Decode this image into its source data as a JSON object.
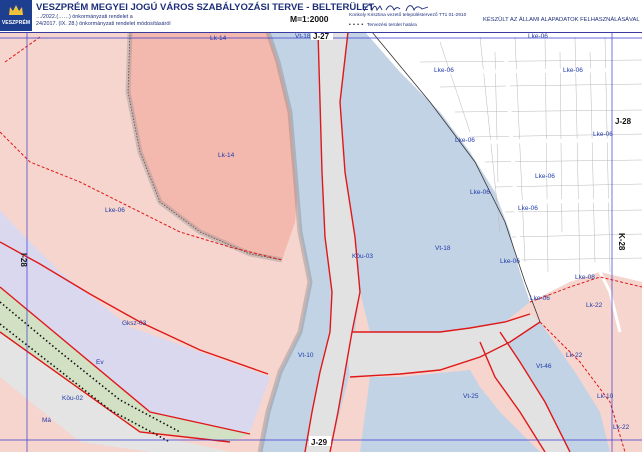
{
  "header": {
    "logo_text": "VESZPRÉM",
    "title": "VESZPRÉM MEGYEI JOGÚ VÁROS SZABÁLYOZÁSI TERVE  -  BELTERÜLET",
    "ordinance_1": "…/2022.(……) önkormányzati rendelet a",
    "ordinance_2": "24/2017. (IX. 28.) önkormányzati rendelet módosításáról",
    "scale": "M=1:2000",
    "designer": "Konkoly Krisztina vezető településtervező   TT1 01-2910",
    "legend_dots": "• • • •",
    "legend_text": "Tervezési terület határa",
    "basemap_note": "KÉSZÜLT AZ ÁLLAMI ALAPADATOK FELHASZNÁLÁSÁVAL"
  },
  "sheets": {
    "top_center": "J-27",
    "bottom_center": "J-29",
    "right_top": "J-28",
    "left": "I-28",
    "right": "K-28"
  },
  "zones": {
    "lk14_top": "Lk-14",
    "lk14_main": "Lk-14",
    "lke06_left": "Lke-06",
    "gksz03": "Gksz-03",
    "ev": "Ev",
    "kou02": "Köu-02",
    "mu": "Má",
    "vt18_top": "Vt-18",
    "vt18": "Vt-18",
    "vt10": "Vt-10",
    "kou03": "Köu-03",
    "vt25": "Vt-25",
    "vt46": "Vt-46",
    "lke06_a": "Lke-06",
    "lke06_b": "Lke-06",
    "lke06_c": "Lke-06",
    "lke06_d": "Lke-06",
    "lke06_e": "Lke-06",
    "lke06_f": "Lke-06",
    "lke06_g": "Lke-06",
    "lke06_h": "Lke-06",
    "lke06_i": "Lke-06",
    "lke06_j": "Lke-06",
    "lke08": "Lke-08",
    "lk22_a": "Lk-22",
    "lk22_b": "Lk-22",
    "lk22_c": "Lk-22",
    "lk10": "Lk-10"
  },
  "colors": {
    "pink_residential": "#f5d5ce",
    "rose_residential": "#f3b8ae",
    "lilac_commercial": "#d9d8ef",
    "blue_building": "#c3d3e6",
    "green_strip": "#d2e0c4",
    "road_gray": "#e2e2e2",
    "regulation_red": "#e01818",
    "boundary_dots": "#222222",
    "label_blue": "#1f3aa8"
  }
}
